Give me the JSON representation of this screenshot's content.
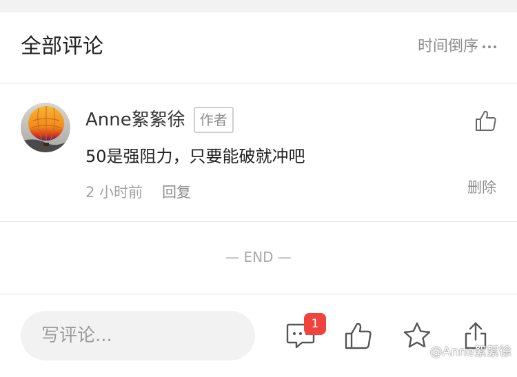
{
  "header": {
    "title": "全部评论",
    "sort_label": "时间倒序",
    "more_icon": "more-dots-icon"
  },
  "comment": {
    "author": "Anne絮絮徐",
    "author_badge": "作者",
    "text": "50是强阻力，只要能破就冲吧",
    "time": "2 小时前",
    "reply_label": "回复",
    "delete_label": "删除",
    "avatar_icon": "hot-air-balloon-avatar",
    "like_icon": "thumbs-up-icon"
  },
  "end_marker": "— END —",
  "bottom_bar": {
    "input_placeholder": "写评论...",
    "comment_count": "1",
    "icons": [
      "comment-icon",
      "thumbs-up-icon",
      "star-icon",
      "share-icon"
    ]
  },
  "watermark": "@Anne絮絮徐",
  "colors": {
    "badge_red": "#f0433b",
    "muted_text": "#8d8d8d",
    "input_bg": "#f2f2f2"
  }
}
